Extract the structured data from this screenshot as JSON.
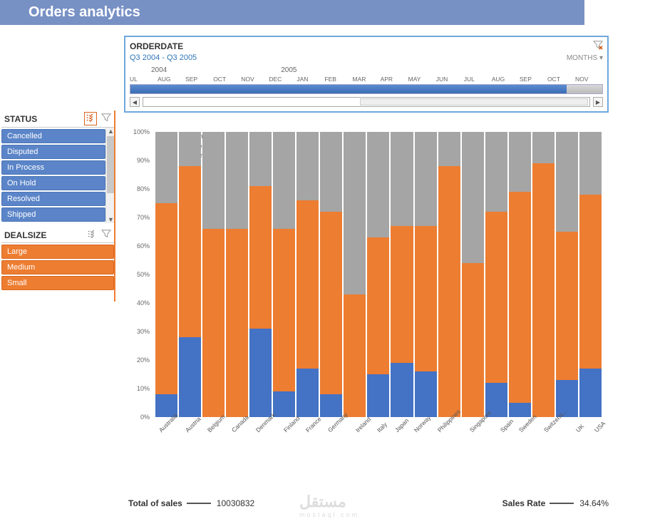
{
  "title": "Orders analytics",
  "slicers": {
    "status": {
      "title": "STATUS",
      "items": [
        "Cancelled",
        "Disputed",
        "In Process",
        "On Hold",
        "Resolved",
        "Shipped"
      ]
    },
    "dealsize": {
      "title": "DEALSIZE",
      "items": [
        "Large",
        "Medium",
        "Small"
      ]
    }
  },
  "timeline": {
    "title": "ORDERDATE",
    "range": "Q3 2004 - Q3 2005",
    "granularity": "MONTHS",
    "year1": "2004",
    "year2": "2005",
    "months": [
      "UL",
      "AUG",
      "SEP",
      "OCT",
      "NOV",
      "DEC",
      "JAN",
      "FEB",
      "MAR",
      "APR",
      "MAY",
      "JUN",
      "JUL",
      "AUG",
      "SEP",
      "OCT",
      "NOV"
    ]
  },
  "footer": {
    "total_label": "Total of sales",
    "total_value": "10030832",
    "rate_label": "Sales Rate",
    "rate_value": "34.64%"
  },
  "watermark": {
    "brand": "مستقل",
    "sub": "mostaql.com"
  },
  "chart_data": {
    "type": "bar",
    "stacked": true,
    "percent": true,
    "ylabel": "%",
    "ylim": [
      0,
      100
    ],
    "yticks": [
      0,
      10,
      20,
      30,
      40,
      50,
      60,
      70,
      80,
      90,
      100
    ],
    "legend": [
      "Small",
      "Medium",
      "Large"
    ],
    "categories": [
      "Australia",
      "Austria",
      "Belgium",
      "Canada",
      "Denmark",
      "Finland",
      "France",
      "Germany",
      "Ireland",
      "Italy",
      "Japan",
      "Norway",
      "Philippines",
      "Singapore",
      "Spain",
      "Sweden",
      "Switzerla...",
      "UK",
      "USA"
    ],
    "series": [
      {
        "name": "Large",
        "color": "#4472c4",
        "values": [
          8,
          28,
          0,
          0,
          31,
          9,
          17,
          8,
          0,
          15,
          19,
          16,
          0,
          0,
          12,
          5,
          0,
          13,
          17
        ]
      },
      {
        "name": "Medium",
        "color": "#ed7d31",
        "values": [
          67,
          60,
          66,
          66,
          50,
          57,
          59,
          64,
          43,
          48,
          48,
          51,
          88,
          54,
          60,
          74,
          89,
          52,
          61
        ]
      },
      {
        "name": "Small",
        "color": "#a5a5a5",
        "values": [
          25,
          12,
          34,
          34,
          19,
          34,
          24,
          28,
          57,
          37,
          33,
          33,
          12,
          46,
          28,
          21,
          11,
          35,
          22
        ]
      }
    ]
  }
}
